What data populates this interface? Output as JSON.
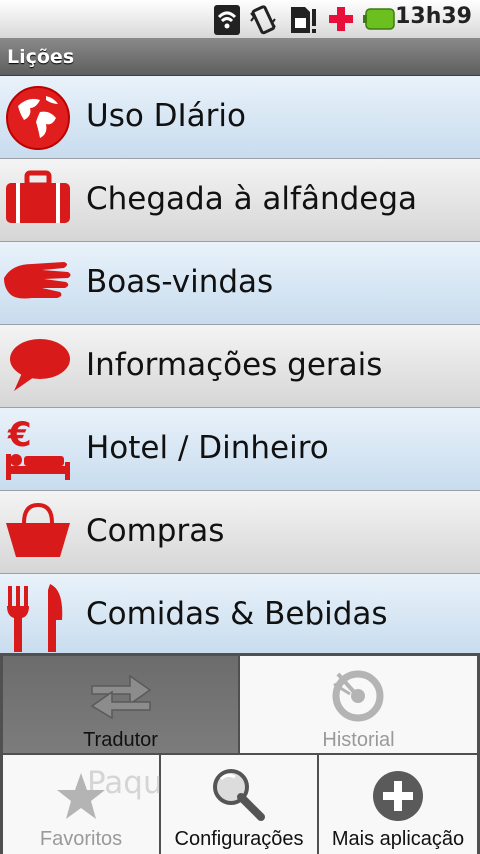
{
  "status_bar": {
    "time": "13h39",
    "icons": [
      "wifi-icon",
      "vibrate-icon",
      "sim-alert-icon",
      "red-cross-icon",
      "battery-icon"
    ]
  },
  "title_bar": {
    "title": "Lições"
  },
  "lessons": [
    {
      "label": "Uso DIário",
      "icon": "globe-icon"
    },
    {
      "label": "Chegada à alfândega",
      "icon": "suitcase-icon"
    },
    {
      "label": "Boas-vindas",
      "icon": "hand-icon"
    },
    {
      "label": "Informações gerais",
      "icon": "speech-bubble-icon"
    },
    {
      "label": "Hotel / Dinheiro",
      "icon": "euro-bed-icon"
    },
    {
      "label": "Compras",
      "icon": "shopping-basket-icon"
    },
    {
      "label": "Comidas & Bebidas",
      "icon": "fork-knife-icon"
    },
    {
      "label": "Paquera",
      "icon": "heart-icon"
    }
  ],
  "menu": {
    "tradutor": {
      "label": "Tradutor",
      "icon": "swap-arrows-icon",
      "selected": true
    },
    "historial": {
      "label": "Historial",
      "icon": "history-icon"
    },
    "favoritos": {
      "label": "Favoritos",
      "icon": "star-icon"
    },
    "configuracoes": {
      "label": "Configurações",
      "icon": "wrench-magnifier-icon"
    },
    "mais": {
      "label": "Mais aplicação",
      "icon": "plus-circle-icon"
    }
  },
  "colors": {
    "accent": "#e02020",
    "row_blue": "#d6e6f4",
    "title_bar": "#6e6e6e"
  }
}
